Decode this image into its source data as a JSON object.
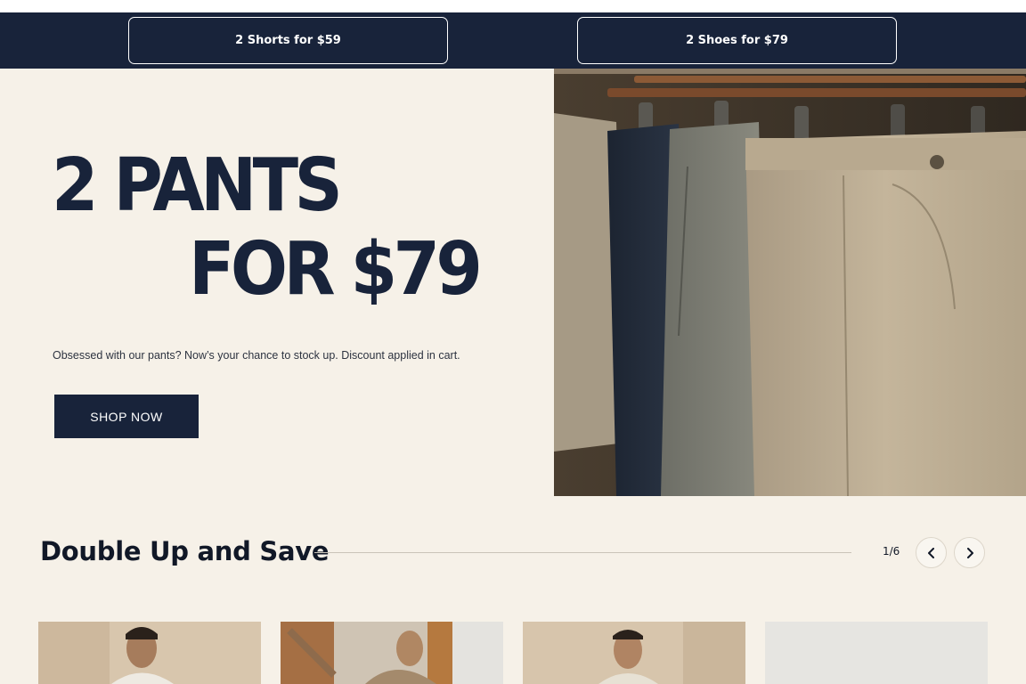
{
  "promo_bar": {
    "left_label": "2 Shorts for $59",
    "right_label": "2 Shoes for $79"
  },
  "hero": {
    "headline_line1": "2 PANTS",
    "headline_line2": "FOR $79",
    "description": "Obsessed with our pants? Now’s your chance to stock up. Discount applied in cart.",
    "cta_label": "SHOP NOW",
    "image_subject": "pants-on-hangers"
  },
  "section": {
    "title": "Double Up and Save",
    "pager": "1/6",
    "prev_icon": "chevron-left-icon",
    "next_icon": "chevron-right-icon"
  },
  "products": [
    {
      "image_subject": "man-in-white-shirt"
    },
    {
      "image_subject": "man-in-tan-shirt"
    },
    {
      "image_subject": "man-in-light-shirt"
    },
    {
      "image_subject": "light-grey-product-background"
    }
  ],
  "colors": {
    "navy": "#18233a",
    "cream": "#f6f1e8",
    "white": "#ffffff"
  }
}
